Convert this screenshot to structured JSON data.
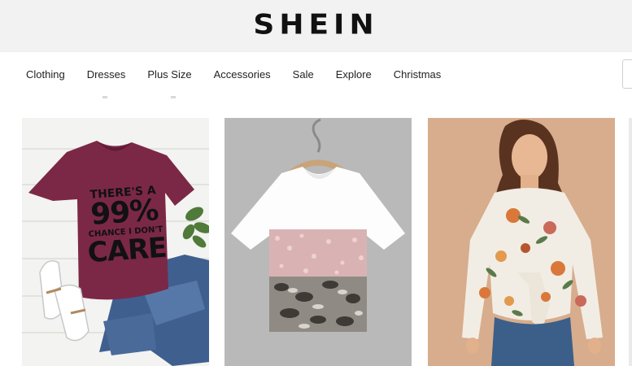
{
  "header": {
    "logo": "SHEIN"
  },
  "nav": {
    "items": [
      {
        "label": "Clothing"
      },
      {
        "label": "Dresses"
      },
      {
        "label": "Plus Size"
      },
      {
        "label": "Accessories"
      },
      {
        "label": "Sale"
      },
      {
        "label": "Explore"
      },
      {
        "label": "Christmas"
      }
    ]
  },
  "products": [
    {
      "image": "maroon graphic t-shirt with jeans and sneakers",
      "print_lines": [
        "THERE'S A",
        "99%",
        "CHANCE I DON'T",
        "CARE"
      ]
    },
    {
      "image": "white t-shirt with pink sequin and snakeskin panel on hanger"
    },
    {
      "image": "model in floral belted long-sleeve blouse"
    },
    {
      "image": "partially visible product"
    }
  ],
  "colors": {
    "header_bg": "#f2f2f2",
    "tee_maroon": "#7b2846",
    "sequin_pink": "#d9b3b3",
    "card3_bg": "#d7ad8d"
  }
}
